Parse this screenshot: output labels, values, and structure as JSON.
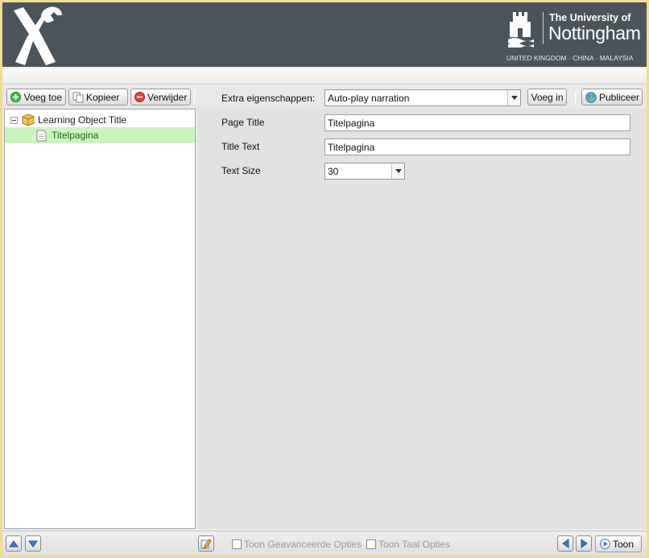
{
  "header": {
    "university_line1": "The University of",
    "university_line2": "Nottingham",
    "university_sub": "UNITED KINGDOM · CHINA · MALAYSIA"
  },
  "toolbar": {
    "add_label": "Voeg toe",
    "copy_label": "Kopieer",
    "delete_label": "Verwijder",
    "extra_props_label": "Extra eigenschappen:",
    "extra_props_selected": "Auto-play narration",
    "insert_label": "Voeg in",
    "publish_label": "Publiceer"
  },
  "tree": {
    "root_label": "Learning Object Title",
    "children": [
      {
        "label": "Titelpagina",
        "selected": true
      }
    ]
  },
  "properties": {
    "fields": [
      {
        "label": "Page Title",
        "value": "Titelpagina"
      },
      {
        "label": "Title Text",
        "value": "Titelpagina"
      },
      {
        "label": "Text Size",
        "value": "30"
      }
    ]
  },
  "statusbar": {
    "advanced_options_label": "Toon Geavanceerde Opties",
    "language_options_label": "Toon Taal Opties",
    "show_label": "Toon"
  },
  "colors": {
    "header_bg": "#4b545b",
    "frame_border": "#f2dc8e",
    "selected_row_bg": "#ccf4c0",
    "selected_row_text": "#1b6a14"
  }
}
